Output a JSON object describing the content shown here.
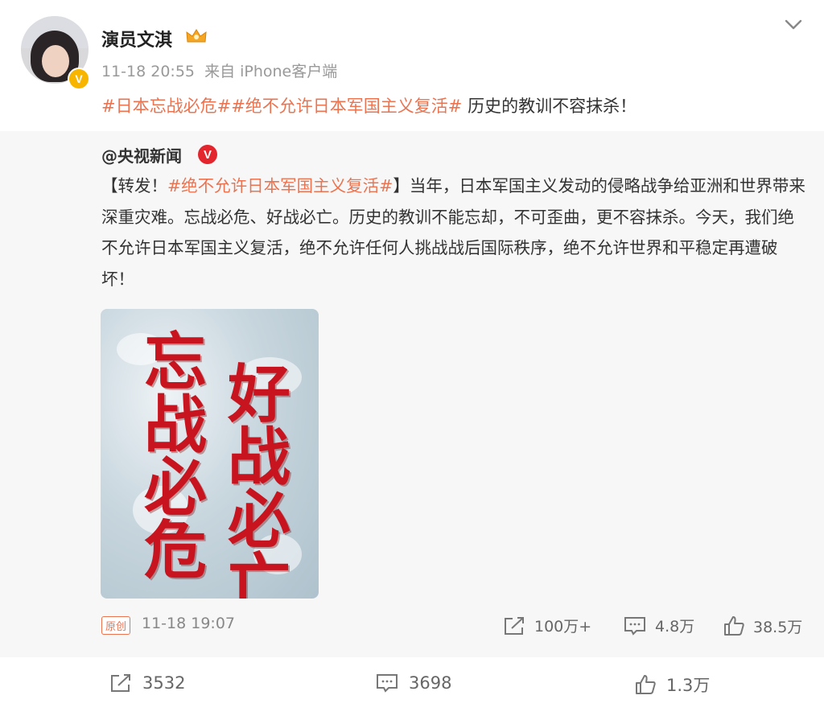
{
  "post": {
    "author": "演员文淇",
    "time": "11-18 20:55",
    "source": "来自 iPhone客户端",
    "topic1": "#日本忘战必危#",
    "topic2": "#绝不允许日本军国主义复活#",
    "text": " 历史的教训不容抹杀！"
  },
  "repost": {
    "author": "@央视新闻",
    "prefix": "【转发！",
    "topic": "#绝不允许日本军国主义复活#",
    "body": "】当年，日本军国主义发动的侵略战争给亚洲和世界带来深重灾难。忘战必危、好战必亡。历史的教训不能忘却，不可歪曲，更不容抹杀。今天，我们绝不允许日本军国主义复活，绝不允许任何人挑战战后国际秩序，绝不允许世界和平稳定再遭破坏！",
    "image_text_left": [
      "忘",
      "战",
      "必",
      "危"
    ],
    "image_text_right": [
      "好",
      "战",
      "必",
      "亡"
    ],
    "badge": "原创",
    "time": "11-18 19:07",
    "reposts": "100万+",
    "comments": "4.8万",
    "likes": "38.5万"
  },
  "actions": {
    "reposts": "3532",
    "comments": "3698",
    "likes": "1.3万"
  },
  "colors": {
    "topic": "#eb7350",
    "poster_text": "#c8141e",
    "verified_gold": "#f7b500",
    "verified_red": "#e3262e"
  },
  "icons": [
    "chevron-down-icon",
    "vip-crown-icon",
    "verified-icon",
    "repost-icon",
    "comment-icon",
    "like-icon"
  ]
}
